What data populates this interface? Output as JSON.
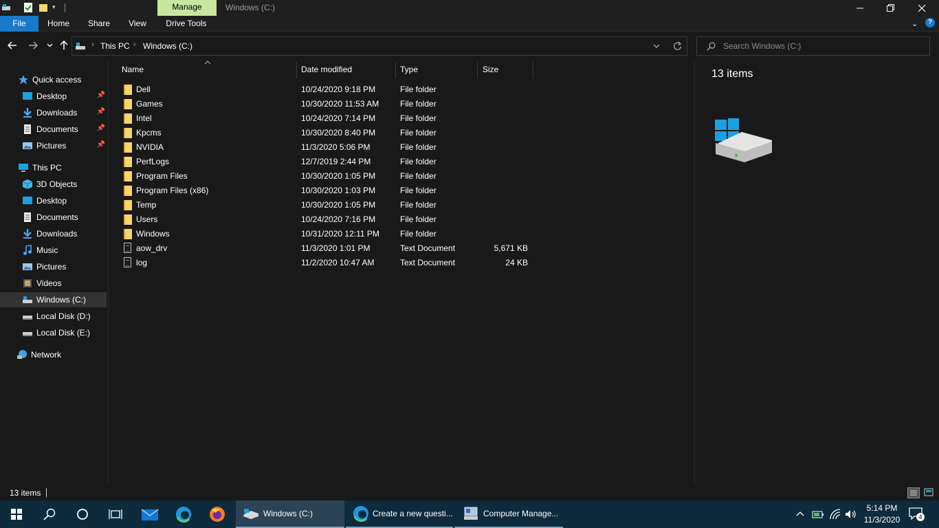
{
  "titlebar": {
    "manage_tab": "Manage",
    "window_title": "Windows (C:)"
  },
  "ribbon": {
    "tabs": [
      "File",
      "Home",
      "Share",
      "View",
      "Drive Tools"
    ]
  },
  "address": {
    "crumbs": [
      "This PC",
      "Windows (C:)"
    ],
    "search_placeholder": "Search Windows (C:)"
  },
  "nav": {
    "quick_access": "Quick access",
    "quick_items": [
      "Desktop",
      "Downloads",
      "Documents",
      "Pictures"
    ],
    "this_pc": "This PC",
    "pc_items": [
      "3D Objects",
      "Desktop",
      "Documents",
      "Downloads",
      "Music",
      "Pictures",
      "Videos",
      "Windows (C:)",
      "Local Disk (D:)",
      "Local Disk (E:)"
    ],
    "network": "Network"
  },
  "columns": {
    "name": "Name",
    "date": "Date modified",
    "type": "Type",
    "size": "Size"
  },
  "files": [
    {
      "name": "Dell",
      "date": "10/24/2020 9:18 PM",
      "type": "File folder",
      "size": "",
      "kind": "folder"
    },
    {
      "name": "Games",
      "date": "10/30/2020 11:53 AM",
      "type": "File folder",
      "size": "",
      "kind": "folder"
    },
    {
      "name": "Intel",
      "date": "10/24/2020 7:14 PM",
      "type": "File folder",
      "size": "",
      "kind": "folder"
    },
    {
      "name": "Kpcms",
      "date": "10/30/2020 8:40 PM",
      "type": "File folder",
      "size": "",
      "kind": "folder"
    },
    {
      "name": "NVIDIA",
      "date": "11/3/2020 5:06 PM",
      "type": "File folder",
      "size": "",
      "kind": "folder"
    },
    {
      "name": "PerfLogs",
      "date": "12/7/2019 2:44 PM",
      "type": "File folder",
      "size": "",
      "kind": "folder"
    },
    {
      "name": "Program Files",
      "date": "10/30/2020 1:05 PM",
      "type": "File folder",
      "size": "",
      "kind": "folder"
    },
    {
      "name": "Program Files (x86)",
      "date": "10/30/2020 1:03 PM",
      "type": "File folder",
      "size": "",
      "kind": "folder"
    },
    {
      "name": "Temp",
      "date": "10/30/2020 1:05 PM",
      "type": "File folder",
      "size": "",
      "kind": "folder"
    },
    {
      "name": "Users",
      "date": "10/24/2020 7:16 PM",
      "type": "File folder",
      "size": "",
      "kind": "folder"
    },
    {
      "name": "Windows",
      "date": "10/31/2020 12:11 PM",
      "type": "File folder",
      "size": "",
      "kind": "folder"
    },
    {
      "name": "aow_drv",
      "date": "11/3/2020 1:01 PM",
      "type": "Text Document",
      "size": "5,671 KB",
      "kind": "doc"
    },
    {
      "name": "log",
      "date": "11/2/2020 10:47 AM",
      "type": "Text Document",
      "size": "24 KB",
      "kind": "doc"
    }
  ],
  "details": {
    "count": "13 items"
  },
  "status": {
    "count": "13 items"
  },
  "taskbar": {
    "apps": [
      "Windows (C:)",
      "Create a new questi...",
      "Computer Manage..."
    ],
    "time": "5:14 PM",
    "date": "11/3/2020",
    "notifications": "4"
  },
  "colors": {
    "accent": "#1979ca",
    "manage": "#c8e6a0",
    "folder": "#f6d66c",
    "taskbar": "#0e2a3d"
  }
}
